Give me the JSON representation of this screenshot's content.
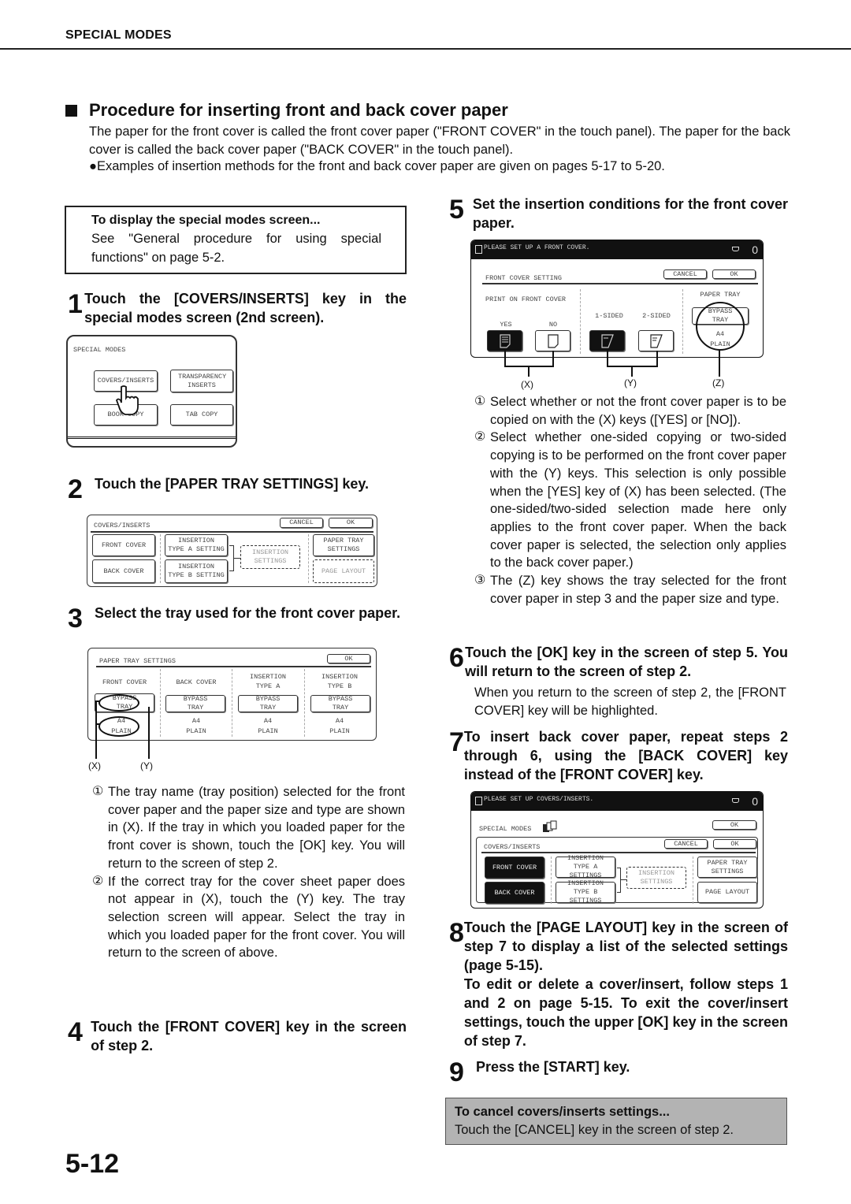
{
  "header": {
    "section": "SPECIAL MODES"
  },
  "title": "Procedure for inserting front and back cover paper",
  "intro": "The paper for the front cover is called the front cover paper (\"FRONT COVER\" in the touch panel). The paper for the back cover is called the back cover paper (\"BACK COVER\" in the touch panel).",
  "bullet": "●Examples of insertion methods for the front and back cover paper are given on pages 5-17 to 5-20.",
  "note": {
    "title": "To display the special modes screen...",
    "body": "See \"General procedure for using special functions\" on page 5-2."
  },
  "steps": [
    {
      "num": "1",
      "text": "Touch the [COVERS/INSERTS] key in the special modes screen (2nd screen)."
    },
    {
      "num": "2",
      "text": "Touch the [PAPER TRAY SETTINGS] key."
    },
    {
      "num": "3",
      "text": "Select the tray used for the front cover paper."
    },
    {
      "num": "4",
      "text": "Touch the [FRONT COVER] key in the screen of step 2."
    },
    {
      "num": "5",
      "text": "Set the insertion conditions for the front cover paper."
    },
    {
      "num": "6",
      "text": "Touch the [OK] key in the screen of step 5. You will return to the screen of step 2."
    },
    {
      "num": "7",
      "text": "To insert back cover paper, repeat steps 2 through 6, using the [BACK COVER] key instead of the [FRONT COVER] key."
    },
    {
      "num": "8",
      "text": "Touch the [PAGE LAYOUT] key in the screen of step 7 to display a list of the selected settings (page 5-15).",
      "text2": "To edit or delete a cover/insert, follow steps 1 and 2 on page 5-15. To exit the cover/insert settings, touch the upper [OK] key in the screen of step 7."
    },
    {
      "num": "9",
      "text": "Press the [START] key."
    }
  ],
  "step3_notes": [
    {
      "mark": "①",
      "text": "The tray name (tray position) selected for the front cover paper and the paper size and type are shown in (X). If the tray in which you loaded paper for the front cover is shown, touch the [OK] key. You will return to the screen of step 2."
    },
    {
      "mark": "②",
      "text": "If the correct tray for the cover sheet paper does not appear in (X), touch the (Y) key. The tray selection screen will appear. Select the tray in which you loaded paper for the front cover. You will return to the screen of above."
    }
  ],
  "step5_notes": [
    {
      "mark": "①",
      "text": "Select whether or not the front cover paper is to be copied on with the (X) keys ([YES] or [NO])."
    },
    {
      "mark": "②",
      "text": "Select whether one-sided copying or two-sided copying is to be performed on the front cover paper with the (Y) keys. This selection is only possible when the [YES] key of (X) has been selected. (The one-sided/two-sided selection made here only applies to the front cover paper. When the back cover paper is selected, the selection only applies to the back cover paper.)"
    },
    {
      "mark": "③",
      "text": "The (Z) key shows the tray selected for the front cover paper in step 3 and the paper size and type."
    }
  ],
  "step6_body": "When you return to the screen of step 2, the [FRONT COVER] key will be highlighted.",
  "cancel_box": {
    "title": "To cancel covers/inserts settings...",
    "body": "Touch the [CANCEL] key in the screen of step 2."
  },
  "page_number": "5-12",
  "panel1": {
    "title": "SPECIAL MODES",
    "keys": [
      "COVERS/INSERTS",
      "TRANSPARENCY INSERTS",
      "BOOK COPY",
      "TAB COPY"
    ],
    "pointer_icon": "hand-pointer-icon"
  },
  "panel2": {
    "title": "COVERS/INSERTS",
    "cancel": "CANCEL",
    "ok": "OK",
    "front_cover": "FRONT COVER",
    "back_cover": "BACK COVER",
    "type_a": [
      "INSERTION",
      "TYPE A SETTING"
    ],
    "type_b": [
      "INSERTION",
      "TYPE B SETTING"
    ],
    "insertion_settings": [
      "INSERTION",
      "SETTINGS"
    ],
    "paper_tray": [
      "PAPER TRAY",
      "SETTINGS"
    ],
    "page_layout": "PAGE LAYOUT"
  },
  "panel3": {
    "title": "PAPER TRAY SETTINGS",
    "ok": "OK",
    "columns": [
      {
        "head": [
          "FRONT COVER"
        ],
        "tray": [
          "BYPASS",
          "TRAY"
        ],
        "size": "A4",
        "type": "PLAIN"
      },
      {
        "head": [
          "BACK COVER"
        ],
        "tray": [
          "BYPASS",
          "TRAY"
        ],
        "size": "A4",
        "type": "PLAIN"
      },
      {
        "head": [
          "INSERTION",
          "TYPE A"
        ],
        "tray": [
          "BYPASS",
          "TRAY"
        ],
        "size": "A4",
        "type": "PLAIN"
      },
      {
        "head": [
          "INSERTION",
          "TYPE B"
        ],
        "tray": [
          "BYPASS",
          "TRAY"
        ],
        "size": "A4",
        "type": "PLAIN"
      }
    ],
    "callouts": [
      "(X)",
      "(Y)"
    ]
  },
  "panel5": {
    "message": "PLEASE SET UP A FRONT COVER.",
    "count": "0",
    "title": "FRONT COVER SETTING",
    "cancel": "CANCEL",
    "ok": "OK",
    "print_on": "PRINT ON FRONT COVER",
    "yes": "YES",
    "no": "NO",
    "one_sided": "1-SIDED",
    "two_sided": "2-SIDED",
    "paper_tray": "PAPER TRAY",
    "tray": [
      "BYPASS",
      "TRAY"
    ],
    "size": "A4",
    "type": "PLAIN",
    "callouts": [
      "(X)",
      "(Y)",
      "(Z)"
    ]
  },
  "panel7": {
    "message": "PLEASE SET UP COVERS/INSERTS.",
    "count": "0",
    "special_modes": "SPECIAL MODES",
    "ok_upper": "OK",
    "title": "COVERS/INSERTS",
    "cancel": "CANCEL",
    "ok": "OK",
    "front_cover": "FRONT COVER",
    "back_cover": "BACK COVER",
    "type_a": [
      "INSERTION",
      "TYPE A SETTINGS"
    ],
    "type_b": [
      "INSERTION",
      "TYPE B SETTINGS"
    ],
    "insertion_settings": [
      "INSERTION",
      "SETTINGS"
    ],
    "paper_tray": [
      "PAPER TRAY",
      "SETTINGS"
    ],
    "page_layout": "PAGE LAYOUT"
  }
}
